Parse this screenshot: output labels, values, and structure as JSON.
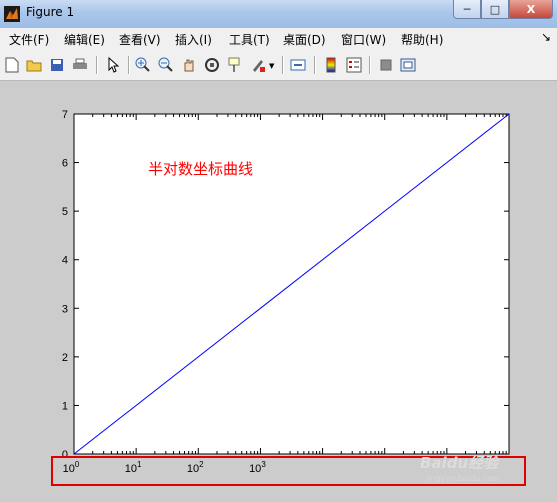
{
  "window": {
    "title": "Figure 1"
  },
  "menu": [
    "文件(F)",
    "编辑(E)",
    "查看(V)",
    "插入(I)",
    "工具(T)",
    "桌面(D)",
    "窗口(W)",
    "帮助(H)"
  ],
  "window_buttons": {
    "minimize": "─",
    "maximize": "□",
    "close": "X"
  },
  "toolbar_icons": [
    "new-figure-icon",
    "open-file-icon",
    "save-icon",
    "print-icon",
    "pointer-icon",
    "zoom-in-icon",
    "zoom-out-icon",
    "pan-hand-icon",
    "rotate-3d-icon",
    "data-cursor-icon",
    "brush-icon",
    "link-plot-icon",
    "colorbar-icon",
    "legend-icon",
    "hide-plot-tools-icon",
    "show-plot-tools-icon"
  ],
  "chart_data": {
    "type": "line",
    "xscale": "log",
    "xlim": [
      1,
      10000000
    ],
    "ylim": [
      0,
      7
    ],
    "y_ticks": [
      "0",
      "1",
      "2",
      "3",
      "4",
      "5",
      "6",
      "7"
    ],
    "x_ticks": [
      {
        "base": "10",
        "exp": "0"
      },
      {
        "base": "10",
        "exp": "1"
      },
      {
        "base": "10",
        "exp": "2"
      },
      {
        "base": "10",
        "exp": "3"
      }
    ],
    "series": [
      {
        "x": [
          1,
          10000000
        ],
        "y": [
          0,
          7
        ],
        "color": "#0000ff"
      }
    ],
    "annotation": {
      "text": "半对数坐标曲线",
      "color": "#ff0000"
    }
  },
  "watermark": {
    "text": "Baidu经验",
    "url": "jingyan.baidu.com"
  }
}
